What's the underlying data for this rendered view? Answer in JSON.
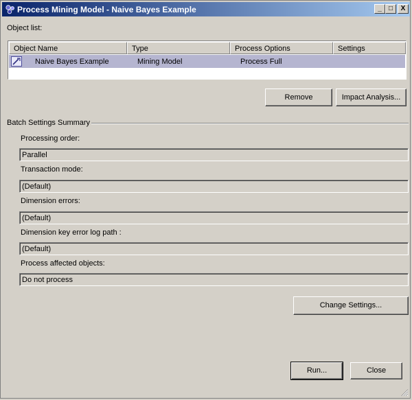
{
  "window": {
    "title": "Process Mining Model - Naive Bayes Example",
    "controls": {
      "minimize": "_",
      "maximize": "□",
      "close": "X"
    }
  },
  "object_list": {
    "label": "Object list:",
    "columns": [
      "Object Name",
      "Type",
      "Process Options",
      "Settings"
    ],
    "rows": [
      {
        "icon": "mining-model-icon",
        "name": "Naive Bayes Example",
        "type": "Mining Model",
        "process_options": "Process Full",
        "settings": ""
      }
    ]
  },
  "actions": {
    "remove": "Remove",
    "impact_analysis": "Impact Analysis..."
  },
  "batch": {
    "title": "Batch Settings Summary",
    "processing_order_label": "Processing order:",
    "processing_order_value": "Parallel",
    "transaction_mode_label": "Transaction mode:",
    "transaction_mode_value": "(Default)",
    "dimension_errors_label": "Dimension errors:",
    "dimension_errors_value": "(Default)",
    "dimension_key_error_log_path_label": "Dimension key error log path :",
    "dimension_key_error_log_path_value": "(Default)",
    "process_affected_objects_label": "Process affected objects:",
    "process_affected_objects_value": "Do not process",
    "change_settings": "Change Settings..."
  },
  "footer": {
    "run": "Run...",
    "close": "Close"
  },
  "colors": {
    "title_start": "#0a246a",
    "title_end": "#a6caf0",
    "selection": "#b5b5d0",
    "face": "#d4d0c8"
  }
}
